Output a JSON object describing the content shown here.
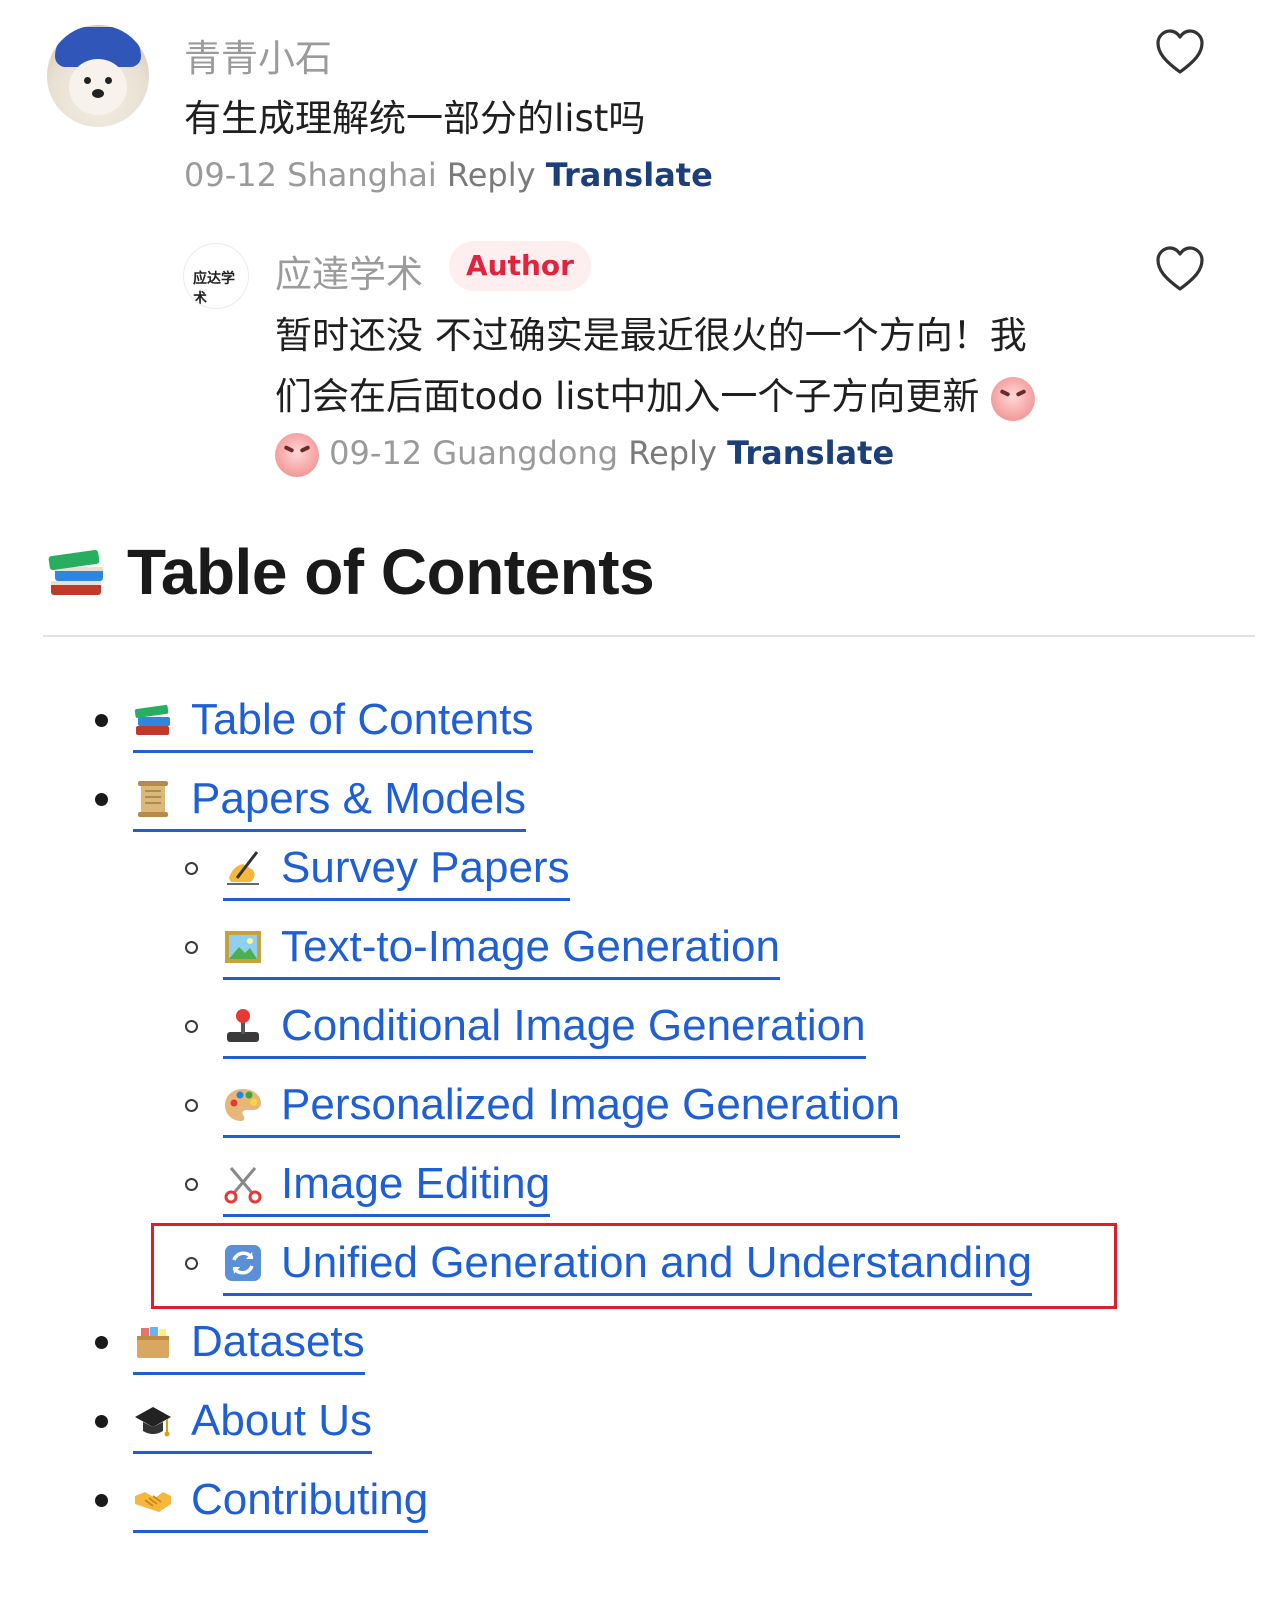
{
  "comments": {
    "main": {
      "username": "青青小石",
      "text": "有生成理解统一部分的list吗",
      "date": "09-12",
      "location": "Shanghai",
      "reply_label": "Reply",
      "translate_label": "Translate"
    },
    "reply": {
      "username": "应達学术",
      "badge": "Author",
      "avatar_text": "应达学术",
      "text_line1": "暂时还没 不过确实是最近很火的一个方向！我",
      "text_line2": "们会在后面todo list中加入一个子方向更新",
      "date": "09-12",
      "location": "Guangdong",
      "reply_label": "Reply",
      "translate_label": "Translate"
    }
  },
  "toc": {
    "heading": "Table of Contents",
    "heading_icon": "books-icon",
    "items": [
      {
        "label": "Table of Contents",
        "icon": "books-icon",
        "level": 1
      },
      {
        "label": "Papers & Models",
        "icon": "scroll-icon",
        "level": 1
      },
      {
        "label": "Survey Papers",
        "icon": "writing-hand-icon",
        "level": 2
      },
      {
        "label": "Text-to-Image Generation",
        "icon": "framed-picture-icon",
        "level": 2
      },
      {
        "label": "Conditional Image Generation",
        "icon": "joystick-icon",
        "level": 2
      },
      {
        "label": "Personalized Image Generation",
        "icon": "palette-icon",
        "level": 2
      },
      {
        "label": "Image Editing",
        "icon": "scissors-icon",
        "level": 2
      },
      {
        "label": "Unified Generation and Understanding",
        "icon": "arrows-cycle-icon",
        "level": 2,
        "highlighted": true
      },
      {
        "label": "Datasets",
        "icon": "card-file-box-icon",
        "level": 1
      },
      {
        "label": "About Us",
        "icon": "graduation-cap-icon",
        "level": 1
      },
      {
        "label": "Contributing",
        "icon": "handshake-icon",
        "level": 1
      }
    ]
  },
  "colors": {
    "link": "#1f5fd6",
    "highlight_border": "#d9202b",
    "author_badge_text": "#e0243f",
    "translate": "#1c3f7a"
  }
}
